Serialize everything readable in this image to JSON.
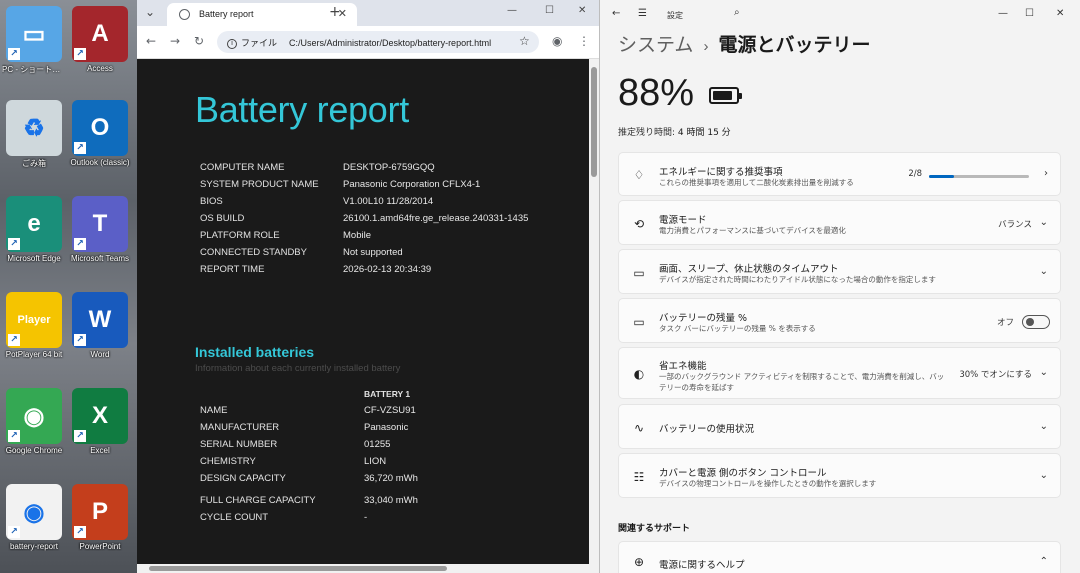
{
  "desktop": {
    "icons": [
      {
        "label": "PC - ショートカット",
        "color": "#57a6e6",
        "glyph": "▭"
      },
      {
        "label": "Access",
        "color": "#a4262c",
        "glyph": "A"
      },
      {
        "label": "ごみ箱",
        "color": "#cfd8dc",
        "glyph": "♻"
      },
      {
        "label": "Outlook (classic)",
        "color": "#0f6cbd",
        "glyph": "O"
      },
      {
        "label": "Microsoft Edge",
        "color": "#1a8f7a",
        "glyph": "e"
      },
      {
        "label": "Microsoft Teams",
        "color": "#5b5fc7",
        "glyph": "T"
      },
      {
        "label": "PotPlayer 64 bit",
        "color": "#f5c400",
        "glyph": "Player"
      },
      {
        "label": "Word",
        "color": "#185abd",
        "glyph": "W"
      },
      {
        "label": "Google Chrome",
        "color": "#34a853",
        "glyph": "◉"
      },
      {
        "label": "Excel",
        "color": "#107c41",
        "glyph": "X"
      },
      {
        "label": "battery-report",
        "color": "#f2f2f2",
        "glyph": "◉"
      },
      {
        "label": "PowerPoint",
        "color": "#c43e1c",
        "glyph": "P"
      }
    ]
  },
  "browser": {
    "tab_title": "Battery report",
    "tab_close": "✕",
    "new_tab": "+",
    "window_controls": {
      "minimize": "—",
      "maximize": "☐",
      "close": "✕"
    },
    "nav": {
      "back": "←",
      "forward": "→",
      "reload": "↻"
    },
    "address": {
      "site_label": "ファイル",
      "url": "C:/Users/Administrator/Desktop/battery-report.html"
    },
    "star": "☆",
    "profile": "◉",
    "menu": "⋮",
    "report": {
      "title": "Battery report",
      "system_rows": [
        {
          "key": "COMPUTER NAME",
          "value": "DESKTOP-6759GQQ"
        },
        {
          "key": "SYSTEM PRODUCT NAME",
          "value": "Panasonic Corporation CFLX4-1"
        },
        {
          "key": "BIOS",
          "value": "V1.00L10 11/28/2014"
        },
        {
          "key": "OS BUILD",
          "value": "26100.1.amd64fre.ge_release.240331-1435"
        },
        {
          "key": "PLATFORM ROLE",
          "value": "Mobile"
        },
        {
          "key": "CONNECTED STANDBY",
          "value": "Not supported"
        },
        {
          "key": "REPORT TIME",
          "value": "2026-02-13  20:34:39"
        }
      ],
      "installed_title": "Installed batteries",
      "installed_sub": "Information about each currently installed battery",
      "battery_header": "BATTERY 1",
      "battery_rows": [
        {
          "key": "NAME",
          "value": "CF-VZSU91"
        },
        {
          "key": "MANUFACTURER",
          "value": "Panasonic"
        },
        {
          "key": "SERIAL NUMBER",
          "value": "01255"
        },
        {
          "key": "CHEMISTRY",
          "value": "LION"
        },
        {
          "key": "DESIGN CAPACITY",
          "value": "36,720 mWh"
        },
        {
          "key": "FULL CHARGE CAPACITY",
          "value": "33,040 mWh"
        },
        {
          "key": "CYCLE COUNT",
          "value": "-"
        }
      ]
    }
  },
  "settings": {
    "app_title": "設定",
    "back": "←",
    "hamburger": "☰",
    "search": "⌕",
    "window_controls": {
      "minimize": "—",
      "maximize": "☐",
      "close": "✕"
    },
    "breadcrumb": {
      "parent": "システム",
      "sep": "›",
      "current": "電源とバッテリー"
    },
    "battery_percent": "88%",
    "battery_level": 0.88,
    "remaining_label": "推定残り時間: ",
    "remaining_value": "4 時間 15 分",
    "cards": [
      {
        "icon": "leaf-icon",
        "glyph": "♢",
        "title": "エネルギーに関する推奨事項",
        "subtitle": "これらの推奨事項を適用して二酸化炭素排出量を削減する",
        "right": "2/8",
        "progress": 0.25,
        "chevron": "›"
      },
      {
        "icon": "power-mode-icon",
        "glyph": "⟲",
        "title": "電源モード",
        "subtitle": "電力消費とパフォーマンスに基づいてデバイスを最適化",
        "right": "バランス",
        "chevron": "⌄"
      },
      {
        "icon": "screen-sleep-icon",
        "glyph": "▭",
        "title": "画面、スリープ、休止状態のタイムアウト",
        "subtitle": "デバイスが指定された時間にわたりアイドル状態になった場合の動作を指定します",
        "chevron": "⌄"
      },
      {
        "icon": "battery-percent-icon",
        "glyph": "▭",
        "title": "バッテリーの残量 %",
        "subtitle": "タスク バーにバッテリーの残量 % を表示する",
        "right": "オフ",
        "toggle": false
      },
      {
        "icon": "energy-saver-icon",
        "glyph": "◐",
        "title": "省エネ機能",
        "subtitle": "一部のバックグラウンド アクティビティを制限することで、電力消費を削減し、バッテリーの寿命を延ばす",
        "right": "30% でオンにする",
        "chevron": "⌄"
      },
      {
        "icon": "usage-chart-icon",
        "glyph": "∿",
        "title": "バッテリーの使用状況",
        "subtitle": "",
        "chevron": "⌄"
      },
      {
        "icon": "lid-buttons-icon",
        "glyph": "☷",
        "title": "カバーと電源 側のボタン コントロール",
        "subtitle": "デバイスの物理コントロールを操作したときの動作を選択します",
        "chevron": "⌄"
      }
    ],
    "related_label": "関連するサポート",
    "help_card": {
      "icon": "globe-icon",
      "glyph": "⊕",
      "title": "電源に関するヘルプ",
      "chevron": "⌃"
    }
  }
}
